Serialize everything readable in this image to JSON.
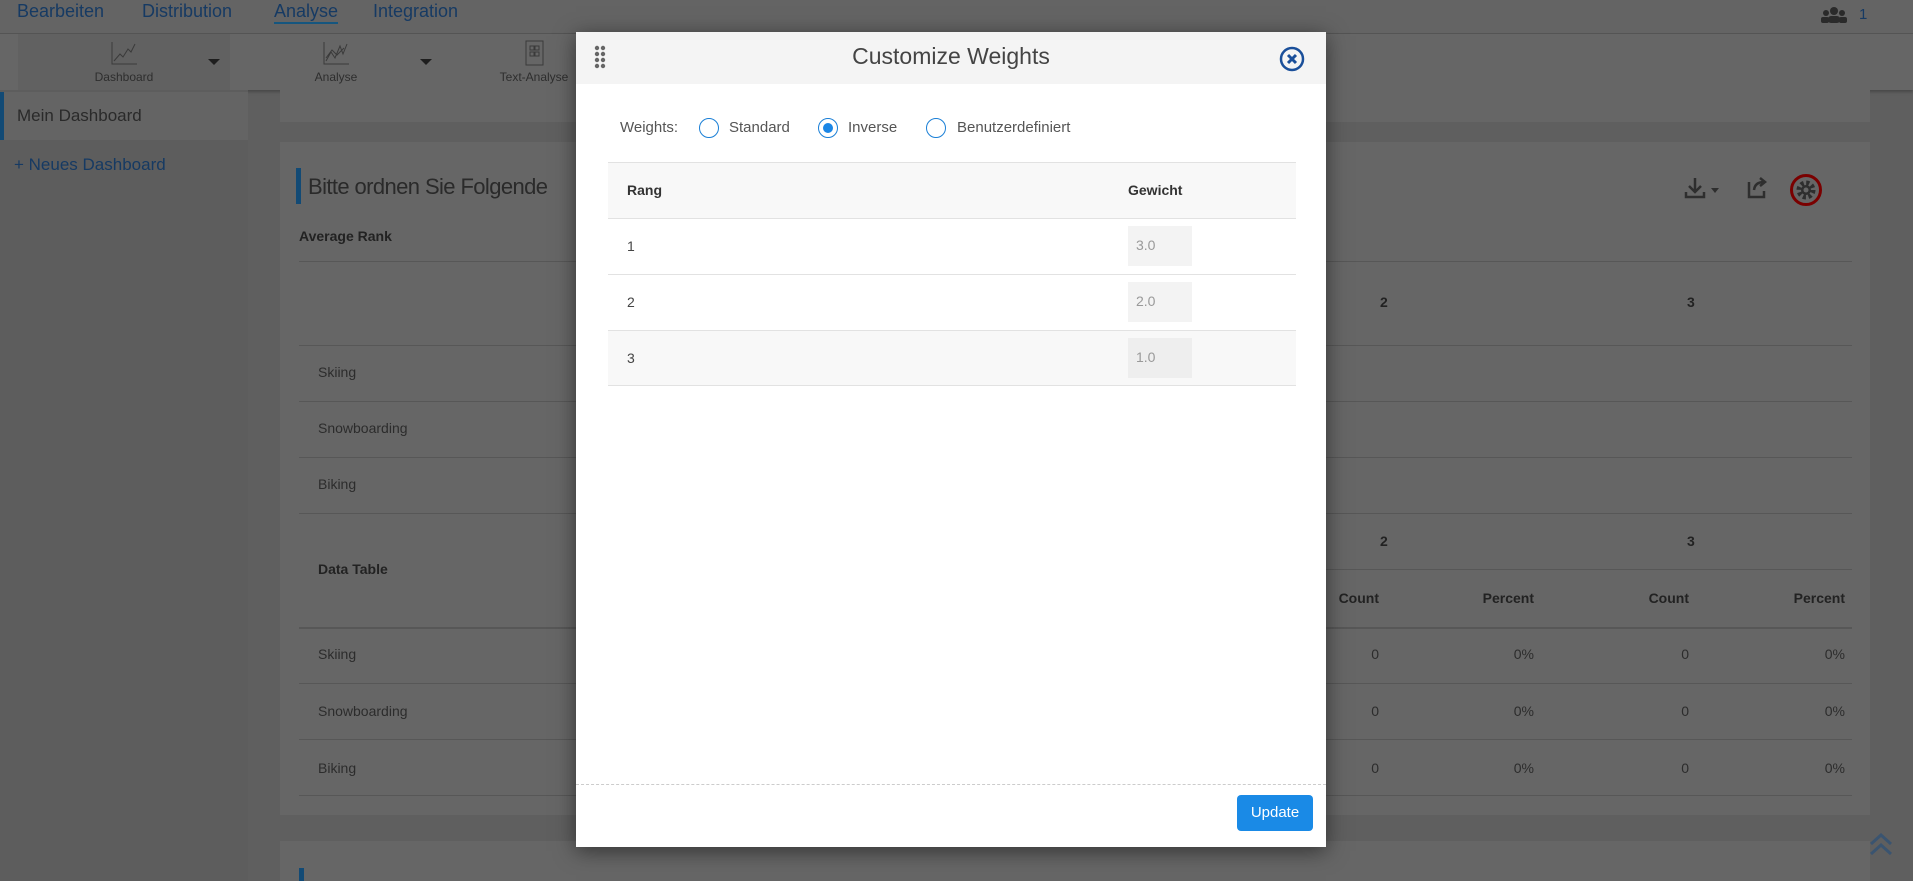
{
  "topnav": {
    "items": [
      "Bearbeiten",
      "Distribution",
      "Analyse",
      "Integration"
    ],
    "active": "Analyse",
    "users_count": "1"
  },
  "toolbar": {
    "tiles": [
      "Dashboard",
      "Analyse",
      "Text-Analyse"
    ]
  },
  "sidebar": {
    "active": "Mein Dashboard",
    "new": "+ Neues Dashboard"
  },
  "widget": {
    "title": "Bitte ordnen Sie Folgende",
    "avg_rank_label": "Average Rank",
    "rank_cols": [
      "2",
      "3"
    ],
    "items": [
      "Skiing",
      "Snowboarding",
      "Biking"
    ],
    "data_table_label": "Data Table",
    "sub_cols": [
      "Count",
      "Percent",
      "Count",
      "Percent"
    ],
    "rows": [
      [
        "0",
        "0%",
        "0",
        "0%"
      ],
      [
        "0",
        "0%",
        "0",
        "0%"
      ],
      [
        "0",
        "0%",
        "0",
        "0%"
      ]
    ]
  },
  "modal": {
    "title": "Customize Weights",
    "weights_label": "Weights:",
    "options": [
      "Standard",
      "Inverse",
      "Benutzerdefiniert"
    ],
    "selected": "Inverse",
    "col_rank": "Rang",
    "col_weight": "Gewicht",
    "rows": [
      {
        "rank": "1",
        "weight": "3.0"
      },
      {
        "rank": "2",
        "weight": "2.0"
      },
      {
        "rank": "3",
        "weight": "1.0"
      }
    ],
    "update_label": "Update"
  },
  "colors": {
    "accent": "#1a8ae6",
    "nav": "#1a4f8a",
    "highlight": "#c00000"
  }
}
